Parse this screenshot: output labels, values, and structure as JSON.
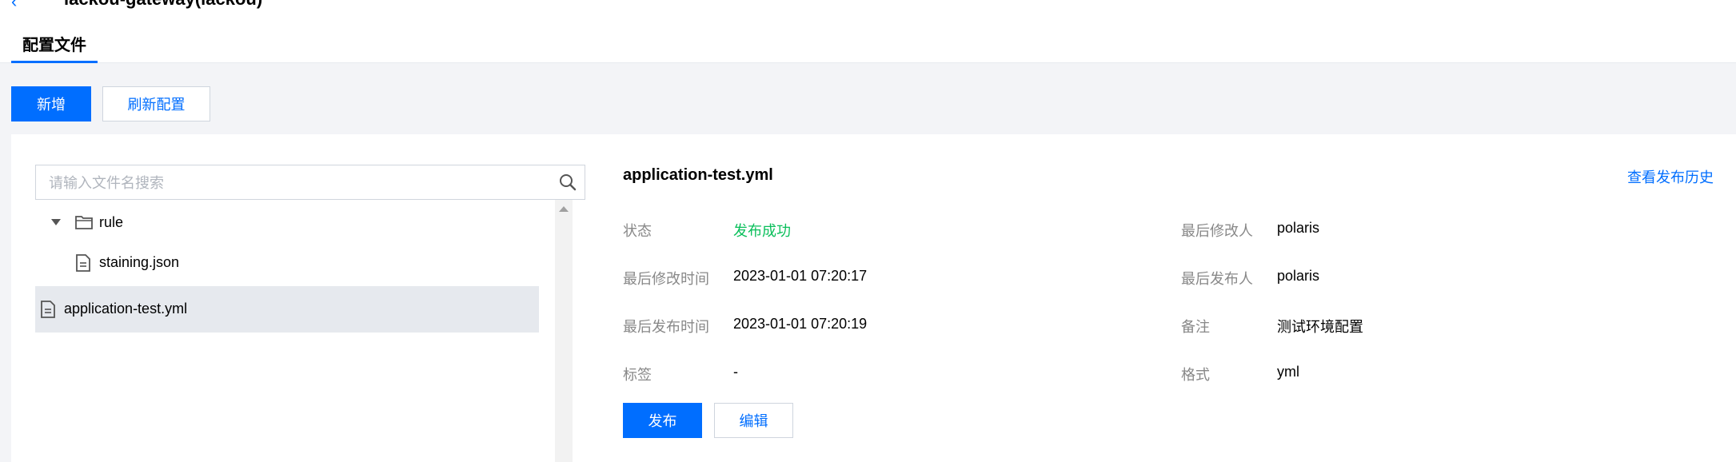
{
  "header": {
    "title": "lackou-gateway(lackou)",
    "tab_config_files": "配置文件"
  },
  "toolbar": {
    "add_label": "新增",
    "refresh_label": "刷新配置"
  },
  "file_tree": {
    "search_placeholder": "请输入文件名搜索",
    "items": [
      {
        "type": "folder",
        "label": "rule",
        "expanded": true
      },
      {
        "type": "file",
        "label": "staining.json"
      },
      {
        "type": "file",
        "label": "application-test.yml",
        "selected": true
      }
    ]
  },
  "detail": {
    "file_name": "application-test.yml",
    "history_link": "查看发布历史",
    "status_label": "状态",
    "status_value": "发布成功",
    "last_modified_time_label": "最后修改时间",
    "last_modified_time_value": "2023-01-01 07:20:17",
    "last_published_time_label": "最后发布时间",
    "last_published_time_value": "2023-01-01 07:20:19",
    "tags_label": "标签",
    "tags_value": "-",
    "last_modifier_label": "最后修改人",
    "last_modifier_value": "polaris",
    "last_publisher_label": "最后发布人",
    "last_publisher_value": "polaris",
    "remark_label": "备注",
    "remark_value": "测试环境配置",
    "format_label": "格式",
    "format_value": "yml",
    "publish_label": "发布",
    "edit_label": "编辑"
  },
  "colors": {
    "primary": "#006eff",
    "success": "#0abf5b",
    "label_gray": "#888888",
    "page_bg": "#f3f4f7"
  }
}
